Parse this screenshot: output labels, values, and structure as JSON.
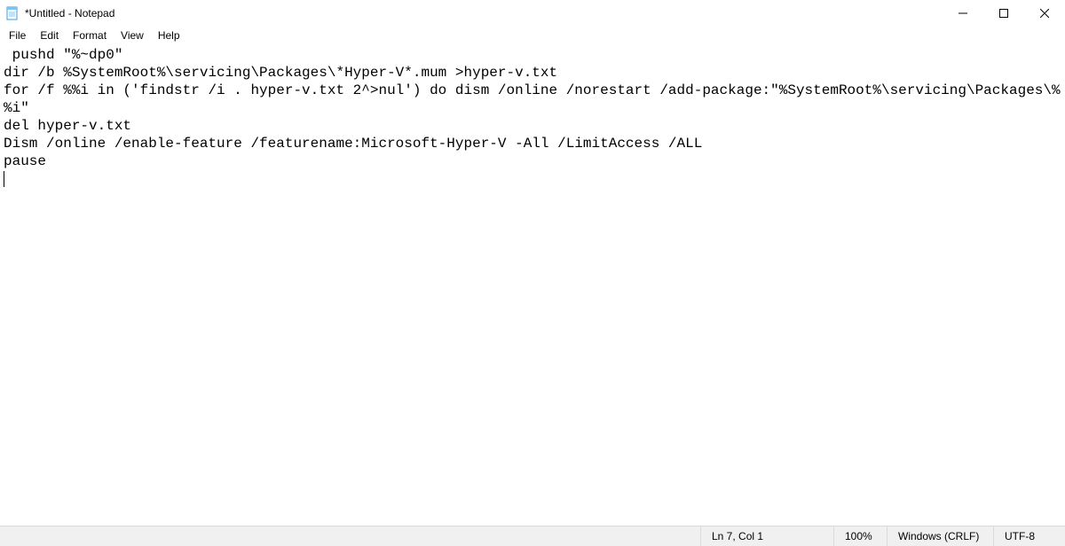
{
  "titlebar": {
    "title": "*Untitled - Notepad"
  },
  "menubar": {
    "items": [
      "File",
      "Edit",
      "Format",
      "View",
      "Help"
    ]
  },
  "editor": {
    "content": " pushd \"%~dp0\"\ndir /b %SystemRoot%\\servicing\\Packages\\*Hyper-V*.mum >hyper-v.txt\nfor /f %%i in ('findstr /i . hyper-v.txt 2^>nul') do dism /online /norestart /add-package:\"%SystemRoot%\\servicing\\Packages\\%%i\"\ndel hyper-v.txt\nDism /online /enable-feature /featurename:Microsoft-Hyper-V -All /LimitAccess /ALL\npause\n"
  },
  "statusbar": {
    "position": "Ln 7, Col 1",
    "zoom": "100%",
    "eol": "Windows (CRLF)",
    "encoding": "UTF-8"
  }
}
